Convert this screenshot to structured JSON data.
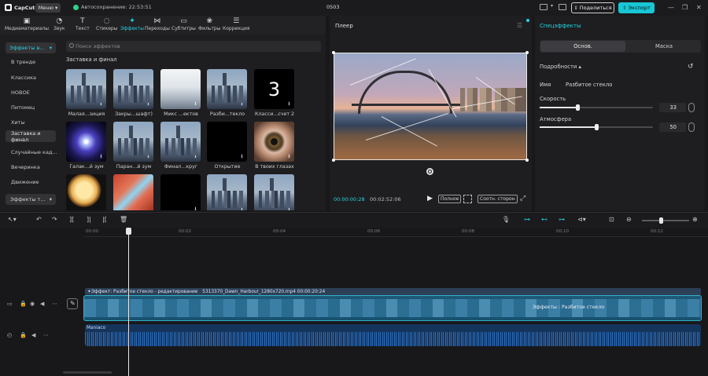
{
  "app": {
    "name": "CapCut",
    "menu_label": "Меню",
    "autosave": "Автосохранение: 22:53:51",
    "project_title": "0503"
  },
  "titlebar": {
    "share_label": "Поделиться",
    "export_label": "Экспорт"
  },
  "toolbar": {
    "items": [
      {
        "label": "Медиаматериалы",
        "icon": "media-icon"
      },
      {
        "label": "Звук",
        "icon": "audio-icon"
      },
      {
        "label": "Текст",
        "icon": "text-icon"
      },
      {
        "label": "Стикеры",
        "icon": "sticker-icon"
      },
      {
        "label": "Эффекты",
        "icon": "effects-icon",
        "active": true
      },
      {
        "label": "Переходы",
        "icon": "transition-icon"
      },
      {
        "label": "Субтитры",
        "icon": "subtitles-icon"
      },
      {
        "label": "Фильтры",
        "icon": "filter-icon"
      },
      {
        "label": "Коррекция",
        "icon": "adjust-icon"
      }
    ]
  },
  "sidebar": {
    "header": "Эффекты в...",
    "items": [
      "В тренде",
      "Классика",
      "НОВОЕ",
      "Питомец",
      "Хиты",
      "Заставка и финал",
      "Случайные кад...",
      "Вечеринка",
      "Движение"
    ],
    "active_index": 5,
    "footer": "Эффекты т..."
  },
  "effects": {
    "search_placeholder": "Поиск эффектов",
    "section_title": "Заставка и финал",
    "tiles": [
      {
        "label": "Малая...зиция",
        "style": "city"
      },
      {
        "label": "Закры...шафт)",
        "style": "city"
      },
      {
        "label": "Микс ...ектов",
        "style": "mist"
      },
      {
        "label": "Разби...текло",
        "style": "city"
      },
      {
        "label": "Класси...счет 2",
        "style": "numtile",
        "digit": "3"
      },
      {
        "label": "Галак...й зум",
        "style": "galaxy"
      },
      {
        "label": "Паран...й зум",
        "style": "city"
      },
      {
        "label": "Финал...круг",
        "style": "city"
      },
      {
        "label": "Открытие",
        "style": "black"
      },
      {
        "label": "В твоих глазах",
        "style": "eye"
      },
      {
        "label": "",
        "style": "moon"
      },
      {
        "label": "",
        "style": "glass"
      },
      {
        "label": "",
        "style": "black"
      },
      {
        "label": "",
        "style": "city"
      },
      {
        "label": "",
        "style": "city"
      }
    ]
  },
  "player": {
    "title": "Плеер",
    "time_current": "00:00:00:28",
    "time_total": "00:02:52:06",
    "full_label": "Полное",
    "ratio_label": "Соотн. сторон"
  },
  "right_panel": {
    "title": "Спецэффекты",
    "tab_basic": "Основ.",
    "tab_mask": "Маска",
    "details_label": "Подробности",
    "name_label": "Имя",
    "name_value": "Разбитое стекло",
    "speed_label": "Скорость",
    "speed_value": "33",
    "atmosphere_label": "Атмосфера",
    "atmosphere_value": "50",
    "speed": 33,
    "atmosphere": 50
  },
  "timeline": {
    "ruler": [
      "00:00",
      "00:02",
      "00:04",
      "00:06",
      "00:08",
      "00:10",
      "00:12"
    ],
    "effect_clip": "Эффект: Разбитое стекло - редактирование",
    "video_clip": "5313370_Dawn_Harbour_1280x720.mp4  00:00:20:24",
    "video_effect_label": "Эффекты : Разбитое стекло",
    "audio_clip": "Maniaco"
  },
  "colors": {
    "accent": "#27d2e0",
    "video_clip": "#1e5a78",
    "audio_clip": "#15345c"
  }
}
